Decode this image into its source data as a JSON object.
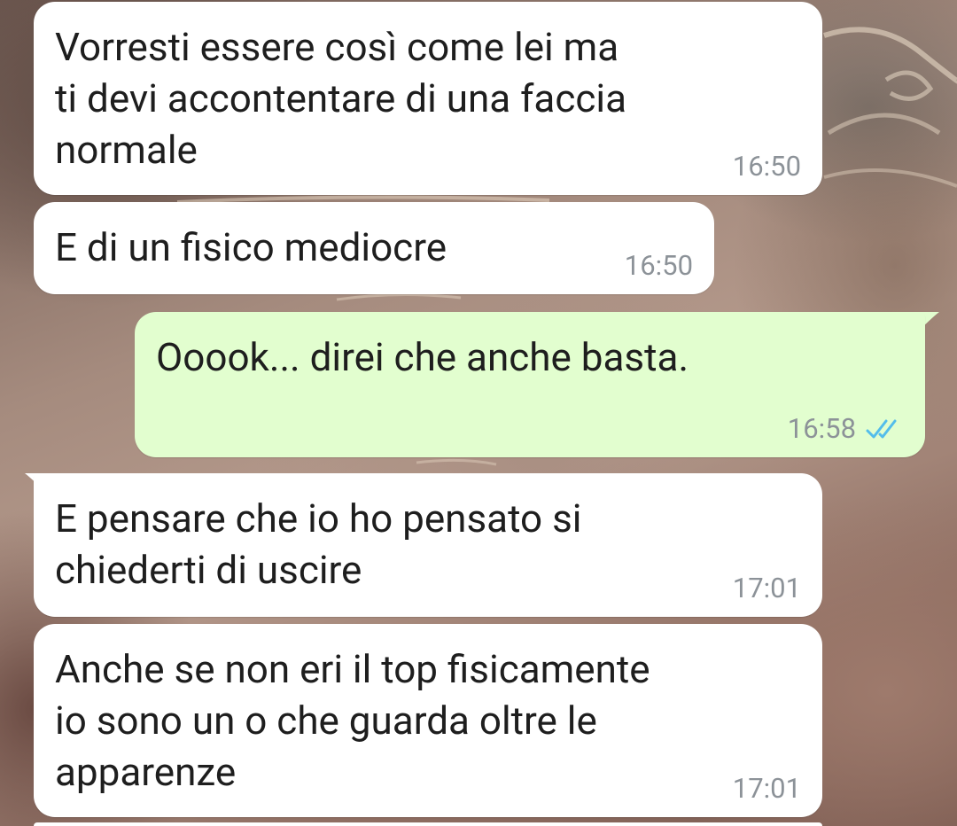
{
  "chat": {
    "messages": [
      {
        "direction": "incoming",
        "text": "Vorresti essere così come lei ma\nti devi accontentare di una faccia\nnormale",
        "time": "16:50"
      },
      {
        "direction": "incoming",
        "text": "E di un fisico mediocre",
        "time": "16:50"
      },
      {
        "direction": "outgoing",
        "text": "Ooook... direi che anche basta.",
        "time": "16:58",
        "status_icon": "double-check-read-icon",
        "status_color": "#53bdeb"
      },
      {
        "direction": "incoming",
        "text": "E pensare che io ho pensato si\nchiederti di uscire",
        "time": "17:01"
      },
      {
        "direction": "incoming",
        "text": "Anche se non eri il top fisicamente\nio sono un o che guarda oltre le\napparenze",
        "time": "17:01"
      }
    ]
  },
  "colors": {
    "incoming_bubble": "#ffffff",
    "outgoing_bubble": "#e2fecf",
    "text": "#1e1e1e",
    "timestamp": "#8c9298"
  }
}
